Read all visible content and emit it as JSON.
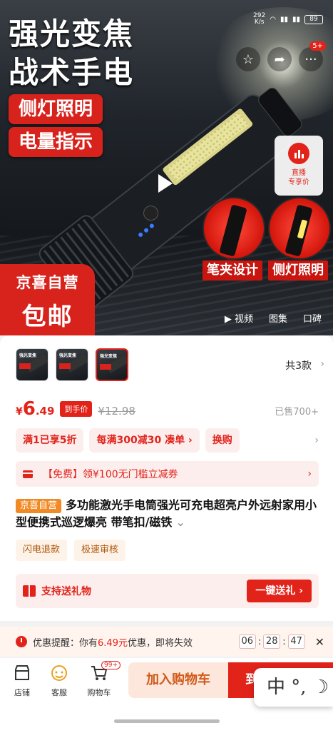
{
  "hero": {
    "title_line1": "强光变焦",
    "title_line2": "战术手电",
    "tag1": "侧灯照明",
    "tag2": "电量指示",
    "caption_left": "笔夹设计",
    "caption_right": "侧灯照明",
    "jx_line1": "京喜自营",
    "jx_line2": "包邮",
    "live_label_1": "直播",
    "live_label_2": "专享价",
    "cart_badge": "5+",
    "media_tabs": [
      "▶ 视频",
      "图集",
      "口碑"
    ]
  },
  "status_bar": {
    "speed_top": "292",
    "speed_bottom": "K/s",
    "battery": "89"
  },
  "product": {
    "styles_count": "共3款",
    "price_currency": "¥",
    "price_int": "6",
    "price_dec": ".49",
    "hand_price_tag": "到手价",
    "orig_price": "¥12.98",
    "sold": "已售700+",
    "promos": [
      "满1已享5折",
      "每满300减30  凑单 ›",
      "换购"
    ],
    "coupon": "【免费】领¥100无门槛立减券",
    "jx_tag": "京喜自营",
    "title": "多功能激光手电筒强光可充电超亮户外远射家用小型便携式巡逻爆亮 带笔扣/磁铁",
    "services": [
      "闪电退款",
      "极速审核"
    ],
    "gift_text": "支持送礼物",
    "gift_button": "一键送礼 ›"
  },
  "reminder": {
    "prefix": "优惠提醒：你有",
    "amount": "6.49元",
    "suffix": "优惠，即将失效",
    "hh": "06",
    "mm": "28",
    "ss": "47"
  },
  "bottom_bar": {
    "store": "店铺",
    "service": "客服",
    "cart": "购物车",
    "cart_count": "99+",
    "add_to_cart": "加入购物车",
    "buy_partial": "到",
    "ime_text": "中 °, ☽"
  },
  "colors": {
    "accent": "#e2231a",
    "jx_orange": "#f08a24"
  }
}
